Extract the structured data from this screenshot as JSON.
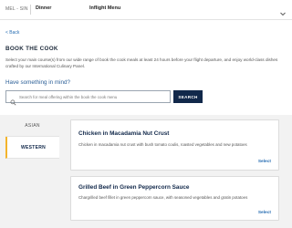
{
  "header": {
    "route": "MEL - SIN",
    "meal": "Dinner",
    "section": "Inflight Menu"
  },
  "icons": [
    "chevron-down-icon",
    "search-icon",
    "back-arrow-icon"
  ],
  "colors": {
    "accent": "#f3b42b",
    "brand_navy": "#11284a",
    "link_blue": "#2a6fb3"
  },
  "back": {
    "label": "< Back"
  },
  "page": {
    "title": "BOOK THE COOK",
    "description": "Select your main course(s) from our wide range of book the cook meals at least 24 hours before your flight departure, and enjoy world-class dishes crafted by our International Culinary Panel."
  },
  "search": {
    "question": "Have something in mind?",
    "placeholder": "Search for meal offering within the book the cook menu",
    "value": "",
    "button_label": "SEARCH"
  },
  "categories": [
    {
      "label": "ASIAN",
      "active": false
    },
    {
      "label": "WESTERN",
      "active": true
    }
  ],
  "dishes": [
    {
      "name": "Chicken in Macadamia Nut Crust",
      "description": "Chicken in macadamia nut crust with bush tomato coulis, roasted vegetables and new potatoes",
      "action": "Select"
    },
    {
      "name": "Grilled Beef in Green Peppercorn Sauce",
      "description": "Chargrilled beef fillet in green peppercorn sauce, with seasoned vegetables and gratin potatoes",
      "action": "Select"
    }
  ]
}
